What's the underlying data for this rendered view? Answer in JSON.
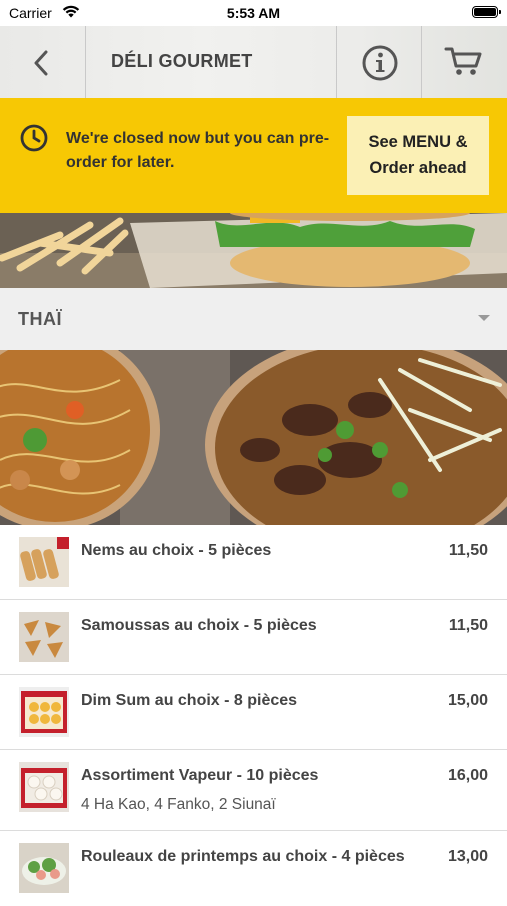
{
  "status_bar": {
    "carrier": "Carrier",
    "time": "5:53 AM"
  },
  "navbar": {
    "title": "DÉLI GOURMET",
    "back_icon": "chevron-left-icon",
    "info_icon": "info-circle-icon",
    "cart_icon": "cart-icon"
  },
  "banner": {
    "message": "We're closed now but you can pre-order for later.",
    "button": "See MENU & Order ahead",
    "icon": "clock-icon",
    "accent": "#f7c804"
  },
  "category": {
    "name": "THAÏ",
    "icon": "caret-down-icon"
  },
  "products": [
    {
      "name": "Nems au choix - 5 pièces",
      "description": "",
      "price": "11,50"
    },
    {
      "name": "Samoussas au choix - 5 pièces",
      "description": "",
      "price": "11,50"
    },
    {
      "name": "Dim Sum au choix - 8 pièces",
      "description": "",
      "price": "15,00"
    },
    {
      "name": "Assortiment Vapeur - 10 pièces",
      "description": "4 Ha Kao, 4 Fanko, 2 Siunaï",
      "price": "16,00"
    },
    {
      "name": "Rouleaux de printemps au choix - 4 pièces",
      "description": "",
      "price": "13,00"
    }
  ]
}
